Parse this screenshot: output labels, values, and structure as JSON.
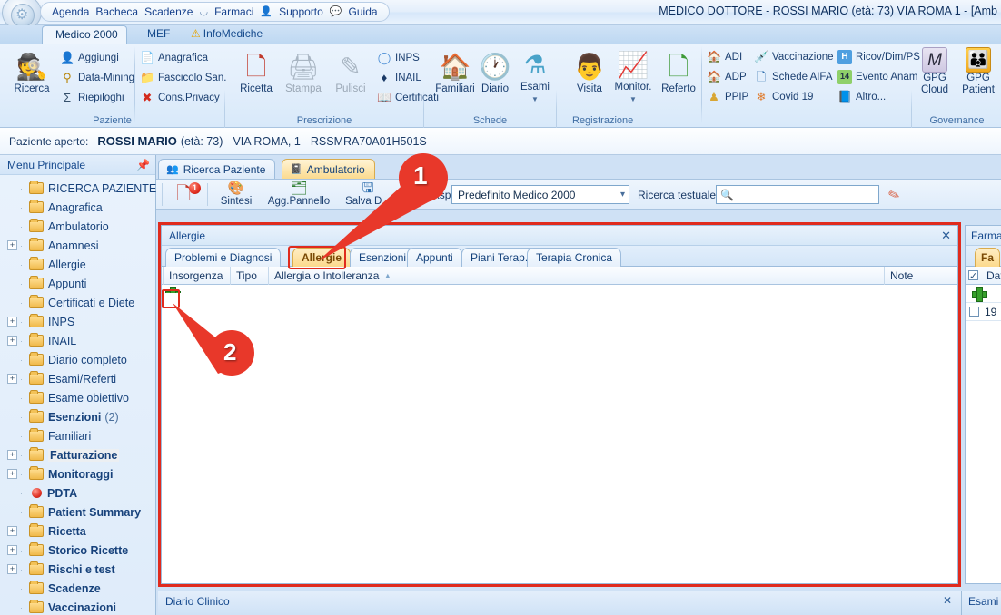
{
  "titlebar": {
    "window_title": "MEDICO DOTTORE - ROSSI MARIO (età: 73) VIA ROMA 1 - [Amb",
    "quick_access": [
      {
        "label": "Agenda",
        "icon": "none"
      },
      {
        "label": "Bacheca",
        "icon": "none"
      },
      {
        "label": "Scadenze",
        "icon": "none"
      },
      {
        "label": "Farmaci",
        "icon": "pill-icon"
      },
      {
        "label": "Supporto",
        "icon": "person-icon"
      },
      {
        "label": "Guida",
        "icon": "help-icon"
      }
    ],
    "orb": "app-orb"
  },
  "ribbon": {
    "tabs": [
      {
        "label": "Medico 2000",
        "active": true
      },
      {
        "label": "MEF",
        "active": false
      },
      {
        "label": "InfoMediche",
        "active": false,
        "icon": "warning-icon"
      }
    ],
    "groups": [
      {
        "caption": "Paziente",
        "big": [
          {
            "label": "Ricerca",
            "icon": "search-person-icon"
          }
        ],
        "small": [
          {
            "label": "Aggiungi",
            "icon": "add-person-icon"
          },
          {
            "label": "Data-Mining",
            "icon": "data-mining-icon"
          },
          {
            "label": "Riepiloghi",
            "icon": "sigma-icon"
          },
          {
            "label": "Anagrafica",
            "icon": "id-card-icon"
          },
          {
            "label": "Fascicolo San.",
            "icon": "folder-icon"
          },
          {
            "label": "Cons.Privacy",
            "icon": "error-icon"
          }
        ]
      },
      {
        "caption": "Prescrizione",
        "big": [
          {
            "label": "Ricetta",
            "icon": "prescription-icon"
          },
          {
            "label": "Stampa",
            "icon": "printer-icon",
            "disabled": true
          },
          {
            "label": "Pulisci",
            "icon": "eraser-icon",
            "disabled": true
          }
        ],
        "small": [
          {
            "label": "INPS",
            "icon": "inps-icon"
          },
          {
            "label": "INAIL",
            "icon": "inail-icon"
          },
          {
            "label": "Certificati",
            "icon": "certificate-icon"
          }
        ]
      },
      {
        "caption": "Schede",
        "big": [
          {
            "label": "Familiari",
            "icon": "house-icon"
          },
          {
            "label": "Diario",
            "icon": "calendar-clock-icon"
          },
          {
            "label": "Esami",
            "icon": "flask-icon",
            "dropdown": true
          }
        ],
        "small": []
      },
      {
        "caption": "Registrazione",
        "big": [
          {
            "label": "Visita",
            "icon": "doctor-icon"
          },
          {
            "label": "Monitor.",
            "icon": "monitor-icon",
            "dropdown": true
          },
          {
            "label": "Referto",
            "icon": "report-add-icon"
          }
        ],
        "small": [
          {
            "label": "ADI",
            "icon": "adi-icon"
          },
          {
            "label": "ADP",
            "icon": "adp-icon"
          },
          {
            "label": "PPIP",
            "icon": "ppip-icon"
          },
          {
            "label": "Vaccinazione",
            "icon": "syringe-icon"
          },
          {
            "label": "Schede AIFA",
            "icon": "aifa-icon"
          },
          {
            "label": "Covid 19",
            "icon": "virus-icon"
          },
          {
            "label": "Ricov/Dim/PS",
            "icon": "hospital-icon"
          },
          {
            "label": "Evento Anam",
            "icon": "calendar14-icon"
          },
          {
            "label": "Altro...",
            "icon": "book-help-icon"
          }
        ]
      },
      {
        "caption": "Governance",
        "big": [
          {
            "label": "GPG\nCloud",
            "icon": "gpg-cloud-icon"
          },
          {
            "label": "GPG\nPatient",
            "icon": "gpg-patient-icon"
          }
        ],
        "small": []
      }
    ]
  },
  "patient_bar": {
    "label": "Paziente aperto:",
    "name": "ROSSI MARIO",
    "details": "(età: 73) - VIA ROMA, 1 - RSSMRA70A01H501S"
  },
  "sidebar": {
    "title": "Menu Principale",
    "pin_icon": "pin-icon",
    "items": [
      {
        "label": "RICERCA PAZIENTE",
        "icon": "folder-icon",
        "expandable": false
      },
      {
        "label": "Anagrafica",
        "icon": "folder-icon",
        "expandable": false
      },
      {
        "label": "Ambulatorio",
        "icon": "folder-icon",
        "expandable": false
      },
      {
        "label": "Anamnesi",
        "icon": "folder-icon",
        "expandable": true
      },
      {
        "label": "Allergie",
        "icon": "folder-icon",
        "expandable": false
      },
      {
        "label": "Appunti",
        "icon": "folder-icon",
        "expandable": false
      },
      {
        "label": "Certificati e Diete",
        "icon": "folder-icon",
        "expandable": false
      },
      {
        "label": "INPS",
        "icon": "folder-icon",
        "expandable": true
      },
      {
        "label": "INAIL",
        "icon": "folder-icon",
        "expandable": true
      },
      {
        "label": "Diario completo",
        "icon": "folder-icon",
        "expandable": false
      },
      {
        "label": "Esami/Referti",
        "icon": "folder-icon",
        "expandable": true
      },
      {
        "label": "Esame obiettivo",
        "icon": "folder-icon",
        "expandable": false
      },
      {
        "label": "Esenzioni",
        "suffix": "(2)",
        "icon": "folder-icon",
        "expandable": false,
        "bold": true
      },
      {
        "label": "Familiari",
        "icon": "folder-icon",
        "expandable": false
      },
      {
        "label": "Fatturazione",
        "icon": "folder-icon",
        "expandable": true,
        "bold": true,
        "selected": true
      },
      {
        "label": "Monitoraggi",
        "icon": "folder-icon",
        "expandable": true,
        "bold": true
      },
      {
        "label": "PDTA",
        "icon": "red-dot-icon",
        "expandable": false,
        "bold": true
      },
      {
        "label": "Patient Summary",
        "icon": "folder-icon",
        "expandable": false,
        "bold": true
      },
      {
        "label": "Ricetta",
        "icon": "folder-icon",
        "expandable": true,
        "bold": true
      },
      {
        "label": "Storico Ricette",
        "icon": "folder-icon",
        "expandable": true,
        "bold": true
      },
      {
        "label": "Rischi e test",
        "icon": "folder-icon",
        "expandable": true,
        "bold": true
      },
      {
        "label": "Scadenze",
        "icon": "folder-icon",
        "expandable": false,
        "bold": true
      },
      {
        "label": "Vaccinazioni",
        "icon": "folder-icon",
        "expandable": false,
        "bold": true
      }
    ]
  },
  "document_tabs": [
    {
      "label": "Ricerca Paziente",
      "icon": "people-icon",
      "active": false
    },
    {
      "label": "Ambulatorio",
      "icon": "notebook-icon",
      "active": true
    }
  ],
  "toolstrip": {
    "items": [
      {
        "label": "",
        "icon": "summary-doc-icon",
        "badge": "1"
      },
      {
        "label": "Sintesi",
        "icon": "sintesi-icon"
      },
      {
        "label": "Agg.Pannello",
        "icon": "add-panel-icon"
      },
      {
        "label": "Salva D...",
        "icon": "save-panel-icon"
      }
    ],
    "workspace_label": "Workspace:",
    "workspace_value": "Predefinito Medico 2000",
    "search_label": "Ricerca testuale",
    "search_value": "",
    "search_icon": "magnifier-icon",
    "eraser_icon": "eraser-icon"
  },
  "allergie_panel": {
    "title": "Allergie",
    "close_icon": "close-icon",
    "tabs": [
      {
        "label": "Problemi e Diagnosi",
        "selected": false
      },
      {
        "label": "Allergie",
        "selected": true
      },
      {
        "label": "Esenzioni",
        "selected": false
      },
      {
        "label": "Appunti",
        "selected": false
      },
      {
        "label": "Piani Terap.",
        "selected": false
      },
      {
        "label": "Terapia Cronica",
        "selected": false
      }
    ],
    "grid": {
      "columns": [
        "Insorgenza",
        "Tipo",
        "Allergia o Intolleranza",
        "Note"
      ],
      "sorted_column": "Allergia o Intolleranza",
      "sort_direction": "asc",
      "rows": [],
      "new_row_icon": "plus-icon"
    }
  },
  "right_panel": {
    "title": "Farmac",
    "tab_label": "Fa",
    "column_header": "Dat",
    "header_checkbox": true,
    "add_icon": "plus-icon",
    "row_value": "19"
  },
  "bottom_dock": {
    "left_title": "Diario Clinico",
    "left_close_icon": "close-icon",
    "right_title": "Esami"
  },
  "callouts": [
    {
      "number": "1",
      "target": "allergie-tab"
    },
    {
      "number": "2",
      "target": "add-allergy-button"
    }
  ],
  "colors": {
    "accent_red": "#e02b1d",
    "ribbon_blue": "#dfecfa",
    "tab_orange": "#fbd98b",
    "text_blue": "#16498d"
  }
}
